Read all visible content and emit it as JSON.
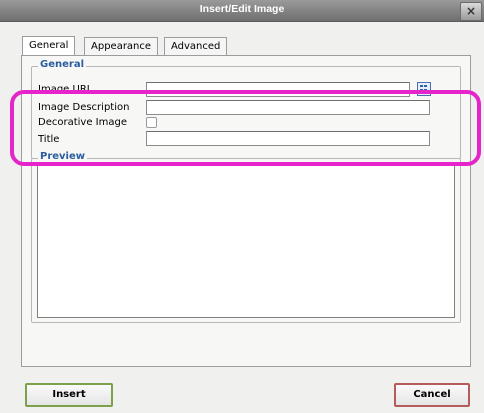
{
  "window": {
    "title": "Insert/Edit Image",
    "close_glyph": "×"
  },
  "tabs": [
    {
      "label": "General",
      "active": true
    },
    {
      "label": "Appearance",
      "active": false
    },
    {
      "label": "Advanced",
      "active": false
    }
  ],
  "general": {
    "legend": "General",
    "image_url": {
      "label": "Image URL",
      "value": ""
    },
    "image_description": {
      "label": "Image Description",
      "value": ""
    },
    "decorative_image": {
      "label": "Decorative Image",
      "checked": false
    },
    "title": {
      "label": "Title",
      "value": ""
    }
  },
  "preview": {
    "legend": "Preview"
  },
  "buttons": {
    "insert": "Insert",
    "cancel": "Cancel"
  },
  "colors": {
    "legend": "#2a5d9f",
    "highlight": "#e524c9",
    "insert_border": "#7ea04c",
    "cancel_border": "#b55b5b"
  },
  "icons": {
    "browse": "browse-file-icon",
    "close": "close-icon"
  }
}
